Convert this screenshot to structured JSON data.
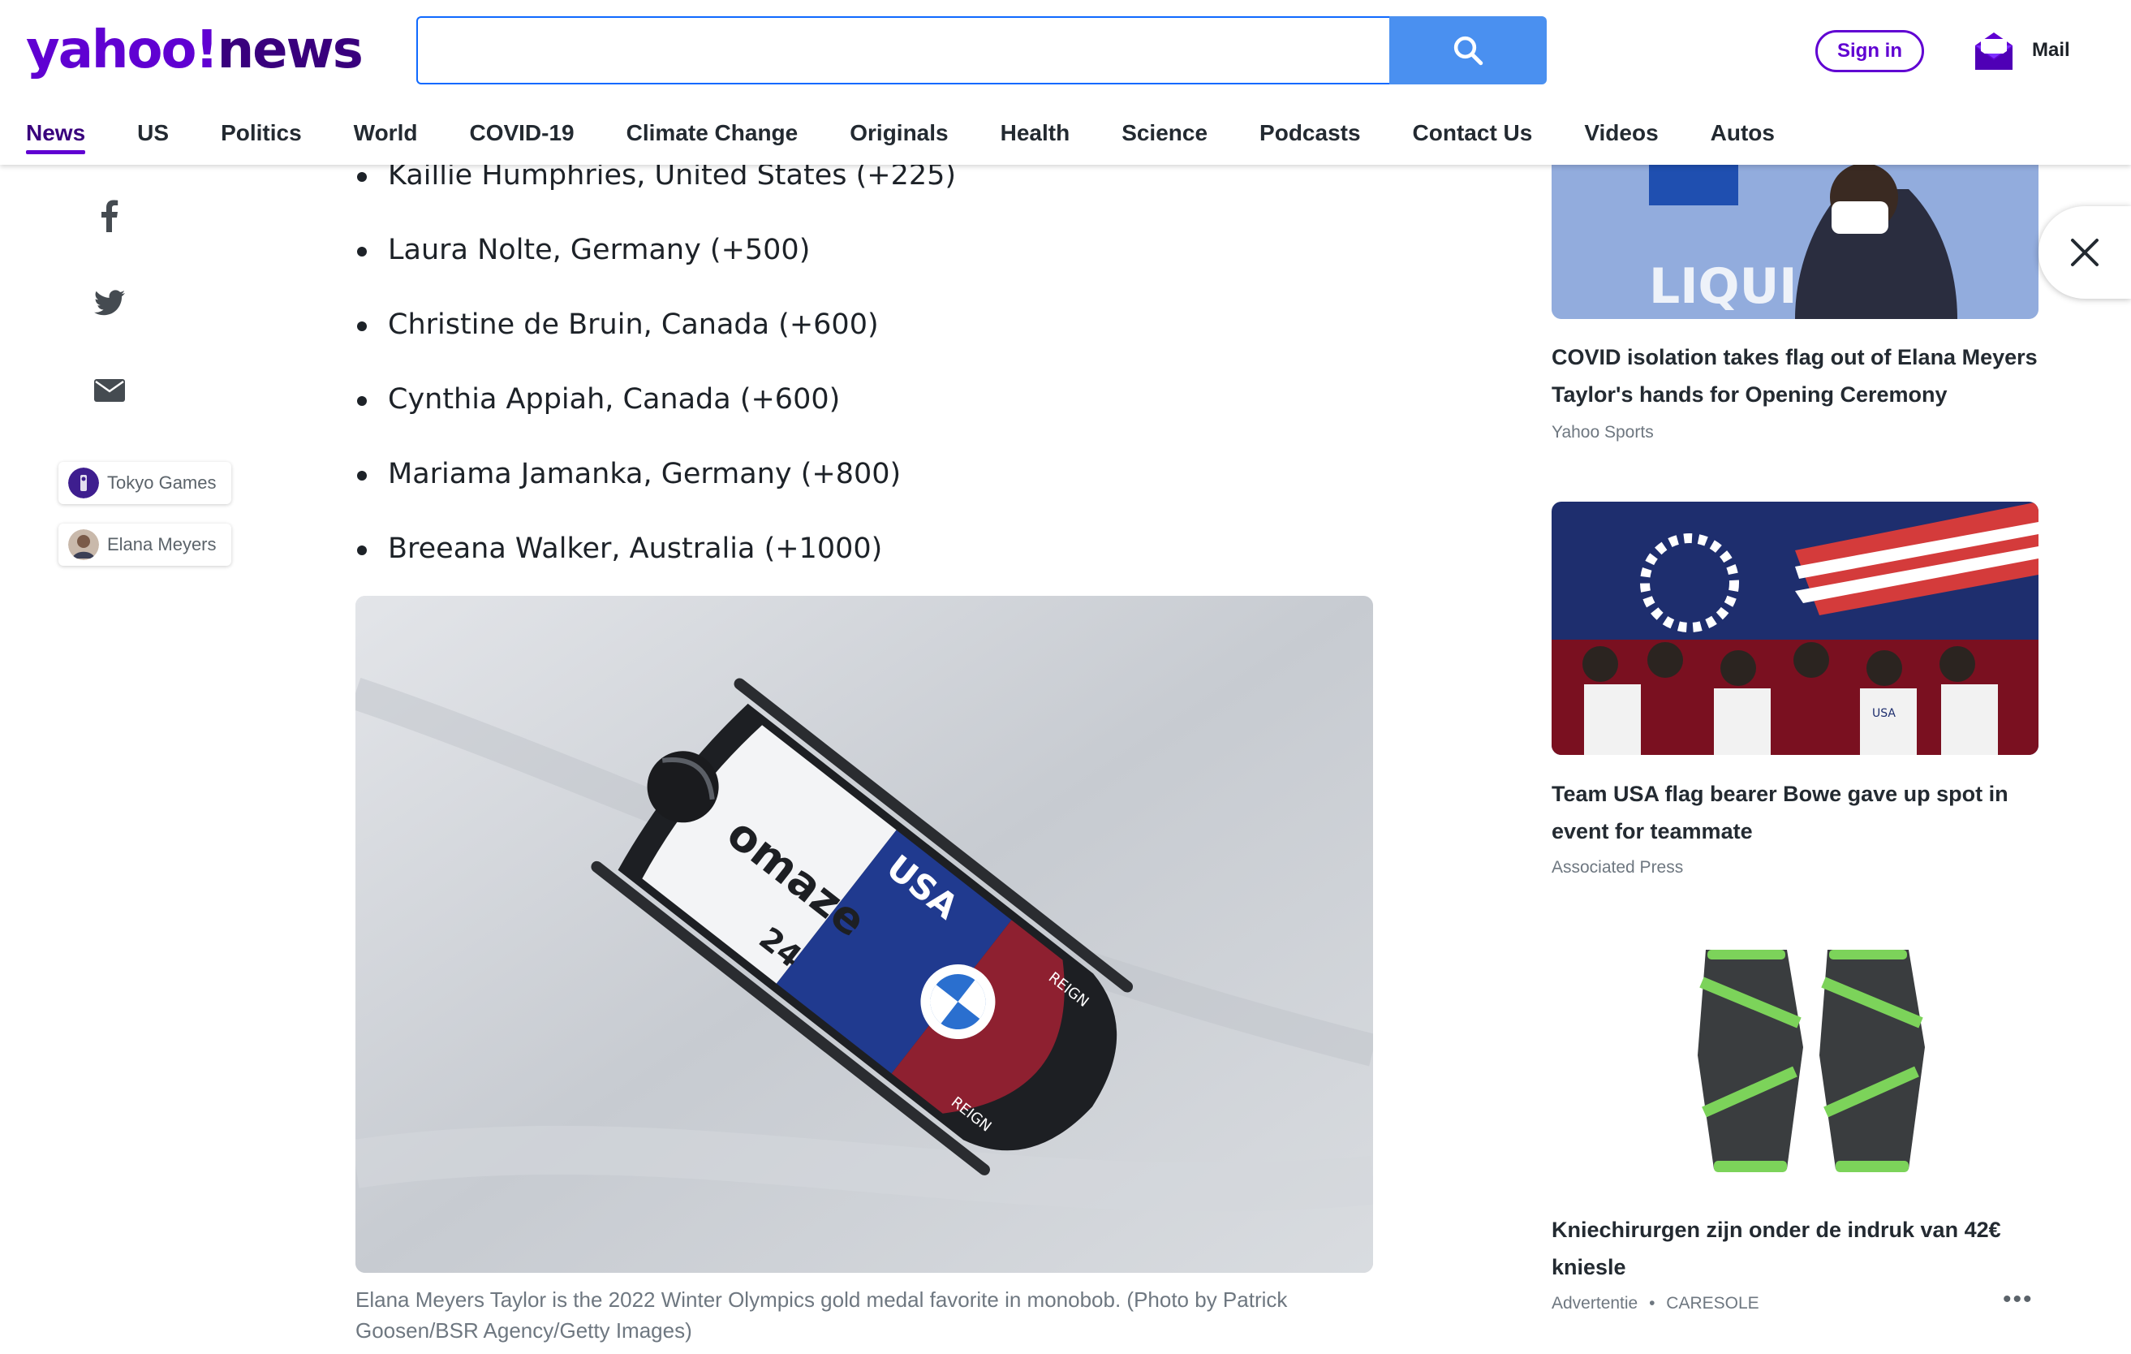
{
  "header": {
    "logo_main": "yahoo!",
    "logo_sub": "news",
    "search_placeholder": "",
    "signin_label": "Sign in",
    "mail_label": "Mail"
  },
  "nav": {
    "items": [
      "News",
      "US",
      "Politics",
      "World",
      "COVID-19",
      "Climate Change",
      "Originals",
      "Health",
      "Science",
      "Podcasts",
      "Contact Us",
      "Videos",
      "Autos"
    ],
    "active": "News"
  },
  "left_rail": {
    "share_icons": [
      "facebook-icon",
      "twitter-icon",
      "mail-icon"
    ],
    "tags": [
      {
        "label": "Tokyo Games"
      },
      {
        "label": "Elana Meyers"
      }
    ]
  },
  "article": {
    "bullets": [
      "Kaillie Humphries, United States (+225)",
      "Laura Nolte, Germany (+500)",
      "Christine de Bruin, Canada (+600)",
      "Cynthia Appiah, Canada (+600)",
      "Mariama Jamanka, Germany (+800)",
      "Breeana Walker, Australia (+1000)"
    ],
    "photo_text": {
      "sled_brand": "omaze",
      "sled_country": "USA",
      "sled_number": "24",
      "side_logo_1": "REIGN",
      "side_logo_2": "REIGN"
    },
    "caption": "Elana Meyers Taylor is the 2022 Winter Olympics gold medal favorite in monobob. (Photo by Patrick Goosen/BSR Agency/Getty Images)"
  },
  "sidebar": {
    "cards": [
      {
        "title": "COVID isolation takes flag out of Elana Meyers Taylor's hands for Opening Ceremony",
        "source": "Yahoo Sports",
        "img_text": "LIQUI"
      },
      {
        "title": "Team USA flag bearer Bowe gave up spot in event for teammate",
        "source": "Associated Press",
        "img_text": "USA"
      },
      {
        "title": "Kniechirurgen zijn onder de indruk van 42€ kniesle",
        "source": "Advertentie",
        "sponsor": "CARESOLE",
        "dot": "•"
      }
    ],
    "more_label": "•••"
  },
  "colors": {
    "brand": "#6001d2",
    "search_button": "#4a90f0",
    "text": "#1d2228"
  }
}
